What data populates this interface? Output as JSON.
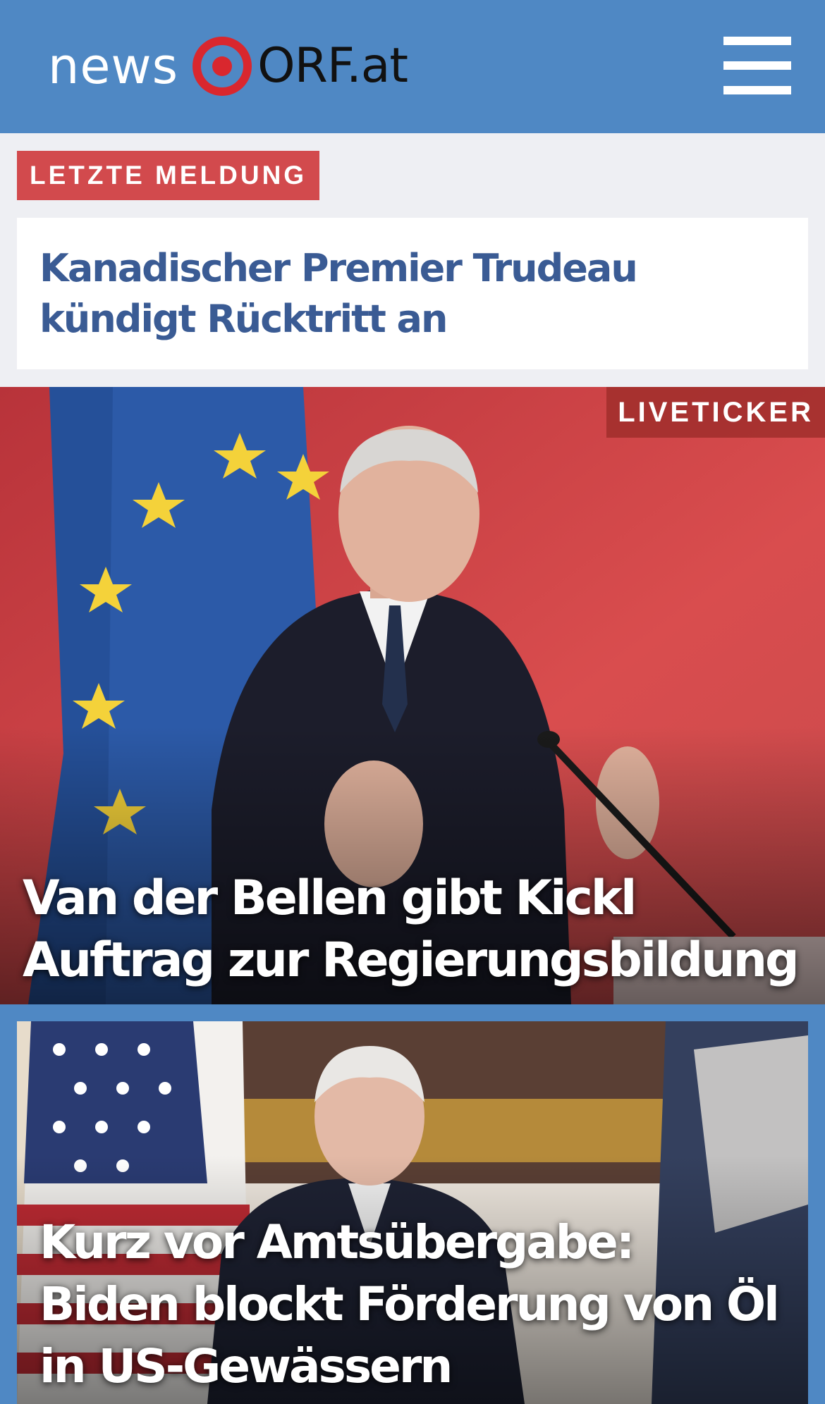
{
  "header": {
    "logo_news": "news",
    "logo_orf": "ORF.at",
    "logo_icon": "orf-eye-icon",
    "menu_icon": "hamburger-menu-icon",
    "background": "#4f88c4"
  },
  "breaking": {
    "label": "LETZTE MELDUNG",
    "headline": "Kanadischer Premier Trudeau kündigt Rücktritt an",
    "label_color": "#d24a4d",
    "headline_color": "#3a5b94"
  },
  "lead_story": {
    "badge": "LIVETICKER",
    "headline": "Van der Bellen gibt Kickl Auftrag zur Regierungsbildung"
  },
  "second_story": {
    "headline": "Kurz vor Amtsübergabe: Biden blockt Förderung von Öl in US-Gewässern"
  }
}
